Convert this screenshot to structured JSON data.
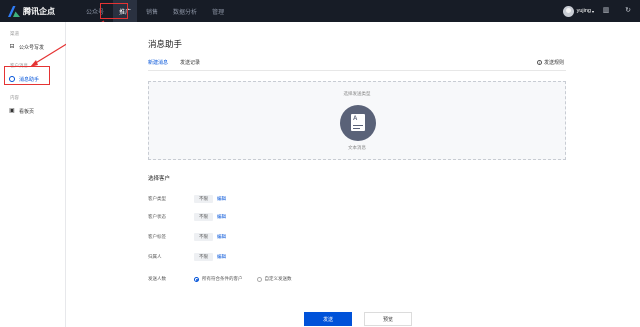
{
  "header": {
    "logo_text": "腾讯企点",
    "nav": [
      {
        "label": "公众号"
      },
      {
        "label": "推广"
      },
      {
        "label": "销售"
      },
      {
        "label": "数据分析"
      },
      {
        "label": "管理"
      }
    ],
    "active_nav": "推广",
    "username": "yujing",
    "user_caret": "▾",
    "icons": [
      "book-icon",
      "refresh-icon"
    ]
  },
  "sidebar": {
    "groups": [
      {
        "label": "渠道",
        "items": [
          {
            "label": "公众号写发",
            "icon": "box-icon"
          }
        ]
      },
      {
        "label": "客户消息",
        "items": [
          {
            "label": "消息助手",
            "icon": "message-icon",
            "active": true
          }
        ]
      },
      {
        "label": "内容",
        "items": [
          {
            "label": "看板页",
            "icon": "page-icon"
          }
        ]
      }
    ]
  },
  "main": {
    "title": "消息助手",
    "tabs": [
      {
        "label": "新建消息",
        "active": true
      },
      {
        "label": "发送记录"
      }
    ],
    "rule_link": "发送规则",
    "drop_area": {
      "title": "选择发送类型",
      "card_label": "文本消息"
    },
    "section_title": "选择客户",
    "filters": [
      {
        "label": "客户类型",
        "tag": "不限",
        "action": "编辑"
      },
      {
        "label": "客户状态",
        "tag": "不限",
        "action": "编辑"
      },
      {
        "label": "客户标签",
        "tag": "不限",
        "action": "编辑"
      },
      {
        "label": "归属人",
        "tag": "不限",
        "action": "编辑"
      }
    ],
    "send_count": {
      "label": "发送人数",
      "options": [
        {
          "label": "所有符合条件的客户",
          "selected": true
        },
        {
          "label": "自定义发送数",
          "selected": false
        }
      ]
    },
    "buttons": {
      "primary": "发送",
      "secondary": "预览"
    }
  },
  "colors": {
    "accent": "#0052d9",
    "topbar": "#171c26",
    "highlight": "#e53333"
  }
}
